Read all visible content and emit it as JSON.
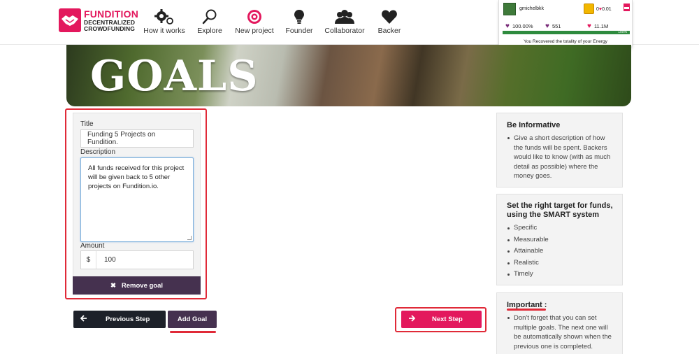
{
  "brand": {
    "name": "FUNDITION",
    "line2": "DECENTRALIZED",
    "line3": "CROWDFUNDING",
    "color": "#e3185d"
  },
  "nav": [
    {
      "label": "How it works",
      "icon": "gears-icon"
    },
    {
      "label": "Explore",
      "icon": "magnifier-icon"
    },
    {
      "label": "New project",
      "icon": "target-icon"
    },
    {
      "label": "Founder",
      "icon": "lightbulb-icon"
    },
    {
      "label": "Collaborator",
      "icon": "group-icon"
    },
    {
      "label": "Backer",
      "icon": "heart-icon"
    }
  ],
  "user": {
    "username": "gmichelbkk",
    "chest_value": "0",
    "heart_value": "0.01",
    "stat1": "100.00%",
    "stat2": "551",
    "stat3": "11.1M",
    "energy_label": "100%",
    "energy_fraction": 1.0,
    "energy_message": "You Recovered the totality of your Energy"
  },
  "hero": {
    "title": "GOALS"
  },
  "form": {
    "title_label": "Title",
    "title_value": "Funding 5 Projects on Fundition.",
    "description_label": "Description",
    "description_value": "All funds received for this project will be given back to 5 other projects on Fundition.io.",
    "amount_label": "Amount",
    "currency": "$",
    "amount_value": "100",
    "remove_label": "Remove goal"
  },
  "actions": {
    "previous_label": "Previous Step",
    "add_goal_label": "Add Goal",
    "next_label": "Next Step"
  },
  "sidebar": {
    "informative": {
      "title": "Be Informative",
      "items": [
        "Give a short description of how the funds will be spent. Backers would like to know (with as much detail as possible) where the money goes."
      ]
    },
    "smart": {
      "title": "Set the right target for funds, using the SMART system",
      "items": [
        "Specific",
        "Measurable",
        "Attainable",
        "Realistic",
        "Timely"
      ]
    },
    "important": {
      "title": "Important :",
      "items": [
        "Don't forget that you can set multiple goals. The next one will be automatically shown when the previous one is completed."
      ]
    }
  }
}
